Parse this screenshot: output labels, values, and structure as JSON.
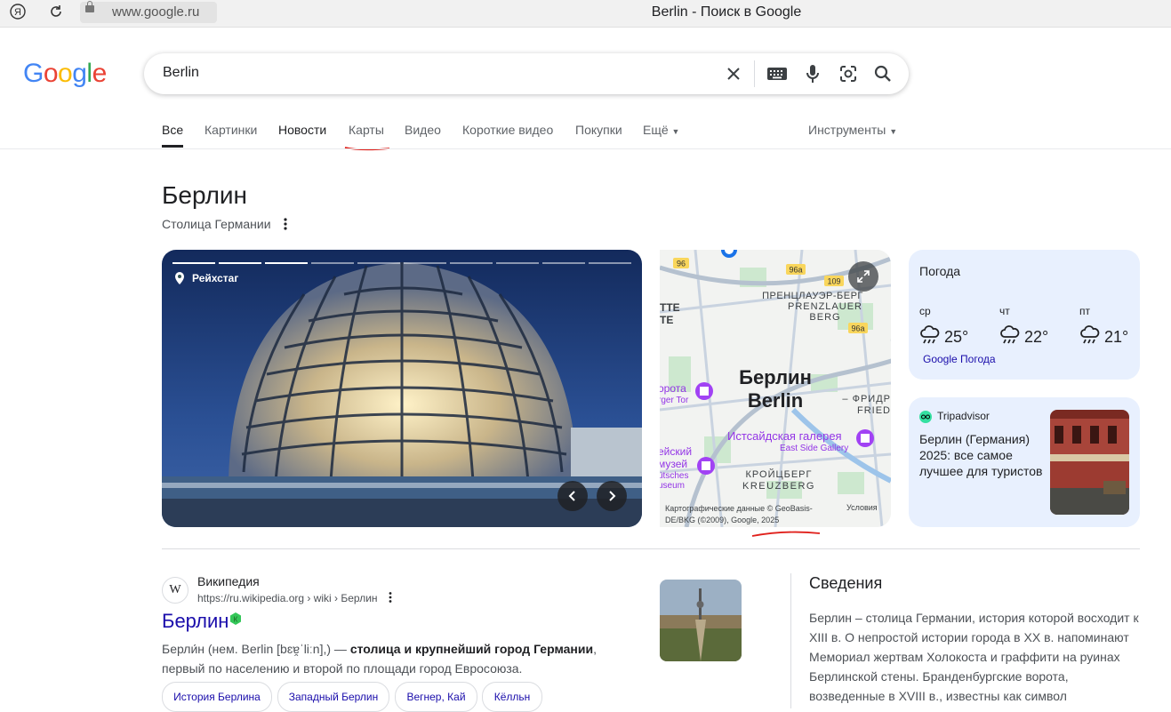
{
  "browser": {
    "url": "www.google.ru",
    "tab_title": "Berlin - Поиск в Google",
    "icons": [
      "yandex-icon",
      "reload-icon",
      "lock-icon"
    ]
  },
  "logo": [
    "G",
    "o",
    "o",
    "g",
    "l",
    "e"
  ],
  "search": {
    "value": "Berlin"
  },
  "tabs": {
    "all": "Все",
    "images": "Картинки",
    "news": "Новости",
    "maps": "Карты",
    "video": "Видео",
    "short_video": "Короткие видео",
    "shopping": "Покупки",
    "more": "Ещё",
    "tools": "Инструменты"
  },
  "entity": {
    "title": "Берлин",
    "subtitle": "Столица Германии"
  },
  "photo": {
    "location_label": "Рейхстаг",
    "segments_total": 10,
    "segments_viewed": 3
  },
  "map": {
    "labels": {
      "district_ne_ru": "ПРЕНЦЛАУЭР-БЕРГ",
      "district_ne_de": "PRENZLAUER",
      "district_ne_de2": "BERG",
      "city_ru": "Берлин",
      "city_de": "Berlin",
      "gallery_ru": "Истсайдская галерея",
      "gallery_de": "East Side Gallery",
      "district_s_ru": "КРОЙЦБЕРГ",
      "district_s_de": "KREUZBERG",
      "gate_ru": "орота",
      "gate_de": "rger Tor",
      "museum_ru1": "ейский",
      "museum_ru2": "музей",
      "museum_de1": "ütsches",
      "museum_de2": "useum",
      "left_edge": "TTE",
      "left_edge2": "TE",
      "right_edge": "– ФРИДР",
      "right_edge2": "FRIED",
      "road_96": "96",
      "road_96a_1": "96a",
      "road_109": "109",
      "road_96a_2": "96a"
    },
    "attribution": "Картографические данные © GeoBasis-DE/BKG (©2009), Google, 2025",
    "terms": "Условия"
  },
  "weather": {
    "title": "Погода",
    "days": [
      {
        "day": "ср",
        "temp": "25°"
      },
      {
        "day": "чт",
        "temp": "22°"
      },
      {
        "day": "пт",
        "temp": "21°"
      }
    ],
    "link": "Google Погода"
  },
  "tripadvisor": {
    "source": "Tripadvisor",
    "title": "Берлин (Германия) 2025: все самое лучшее для туристов"
  },
  "wiki": {
    "favicon": "W",
    "site_name": "Википедия",
    "url": "https://ru.wikipedia.org › wiki › Берлин",
    "title": "Берлин",
    "snippet_line1_plain": "Берли́н (нем. Berlin [bɛɐ̯ˈliːn],) — ",
    "snippet_line1_bold": "столица и крупнейший город Германии",
    "snippet_line1_end": ",",
    "snippet_line2": "первый по населению и второй по площади город Евросоюза.",
    "chips": [
      "История Берлина",
      "Западный Берлин",
      "Вегнер, Кай",
      "Кёлльн"
    ]
  },
  "about": {
    "title": "Сведения",
    "text": "Берлин – столица Германии, история которой восходит к XIII в. О непростой истории города в XX в. напоминают Мемориал жертвам Холокоста и граффити на руинах Берлинской стены. Бранденбургские ворота, возведенные в XVIII в., известны как символ"
  },
  "colors": {
    "link": "#1a0dab",
    "card_bg": "#e8f0fe",
    "annotation_red": "#e0201b"
  }
}
